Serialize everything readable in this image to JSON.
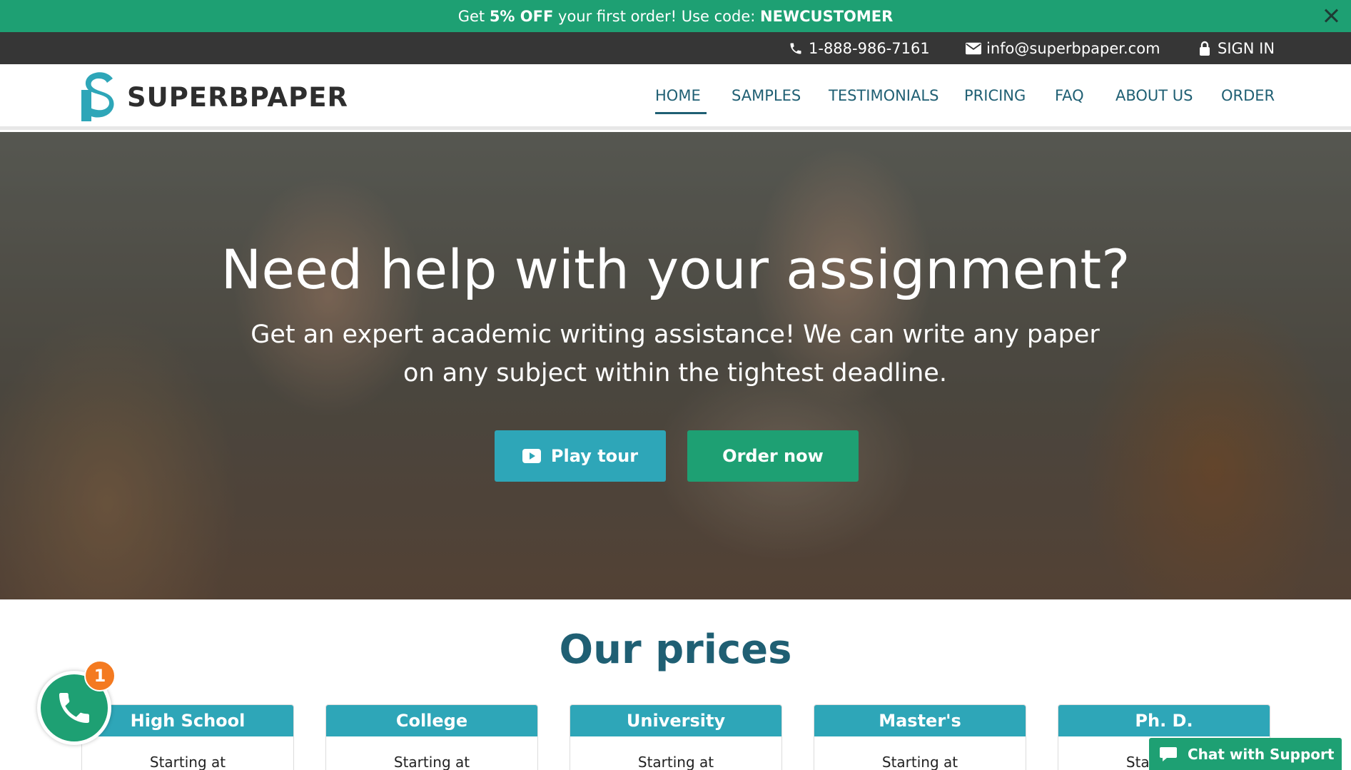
{
  "promo": {
    "prefix": "Get",
    "highlight": "5% OFF",
    "middle": "your first order! Use code:",
    "code": "NEWCUSTOMER",
    "close_icon": "close-icon"
  },
  "contact": {
    "phone": "1-888-986-7161",
    "email": "info@superbpaper.com",
    "signin": "SIGN IN"
  },
  "brand": {
    "name": "SUPERBPAPER",
    "logo_letter": "S",
    "colors": {
      "teal": "#2ea6b8",
      "green": "#1ea073",
      "navy": "#1f5f73",
      "dark": "#363636",
      "orange": "#f47a20"
    }
  },
  "nav": {
    "items": [
      {
        "label": "HOME",
        "active": true
      },
      {
        "label": "SAMPLES"
      },
      {
        "label": "TESTIMONIALS"
      },
      {
        "label": "PRICING"
      },
      {
        "label": "FAQ"
      },
      {
        "label": "ABOUT US"
      },
      {
        "label": "ORDER"
      }
    ]
  },
  "hero": {
    "title": "Need help with your assignment?",
    "subtitle": "Get an expert academic writing assistance! We can write any paper on any subject within the tightest deadline.",
    "play_label": "Play tour",
    "order_label": "Order now"
  },
  "prices": {
    "title": "Our prices",
    "cards": [
      {
        "level": "High School",
        "starting": "Starting at"
      },
      {
        "level": "College",
        "starting": "Starting at"
      },
      {
        "level": "University",
        "starting": "Starting at"
      },
      {
        "level": "Master's",
        "starting": "Starting at"
      },
      {
        "level": "Ph. D.",
        "starting": "Starting at"
      }
    ]
  },
  "widgets": {
    "phone_badge": "1",
    "chat_label": "Chat with Support"
  }
}
